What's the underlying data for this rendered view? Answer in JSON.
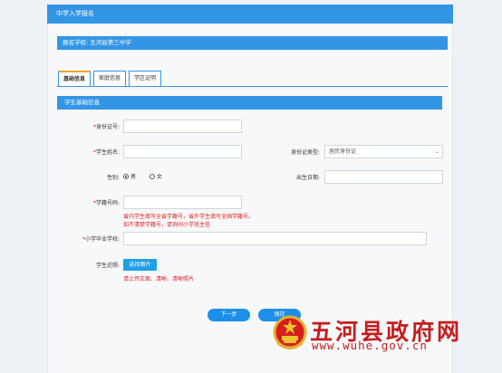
{
  "header": {
    "title": "中学入学报名"
  },
  "school": {
    "label": "报名学校:",
    "name": "五河县第三中学"
  },
  "tabs": [
    {
      "label": "基础信息",
      "active": true
    },
    {
      "label": "家庭信息",
      "active": false
    },
    {
      "label": "学区证明",
      "active": false
    }
  ],
  "section": {
    "title": "学生基础信息"
  },
  "form": {
    "id_number": {
      "label": "身份证号:",
      "required": true,
      "value": ""
    },
    "student_name": {
      "label": "学生姓名:",
      "required": true,
      "value": ""
    },
    "id_type": {
      "label": "身份证类型:",
      "value": "居民身份证"
    },
    "gender": {
      "label": "性别:",
      "options": [
        "男",
        "女"
      ],
      "selected": "男"
    },
    "birth_date": {
      "label": "出生日期:",
      "value": ""
    },
    "student_no": {
      "label": "学籍号码:",
      "required": true,
      "value": "",
      "hint_line1": "省内学生填写全省学籍号，省外学生填写全国学籍号。",
      "hint_line2": "如不清楚学籍号，请询问小学班主任"
    },
    "primary_school": {
      "label": "小学毕业学校:",
      "required": true,
      "value": ""
    },
    "photo": {
      "label": "学生近照:",
      "button": "选择图片",
      "hint": "请上传正面、清晰、清晰照片"
    }
  },
  "actions": {
    "next": "下一步",
    "save": "保存"
  },
  "watermark": {
    "title": "五河县政府网",
    "url": "www.wuhe.gov.cn"
  },
  "colors": {
    "primary": "#3395e6",
    "accent": "#f0a030",
    "error": "#e02020",
    "watermark": "#c61d1d"
  }
}
